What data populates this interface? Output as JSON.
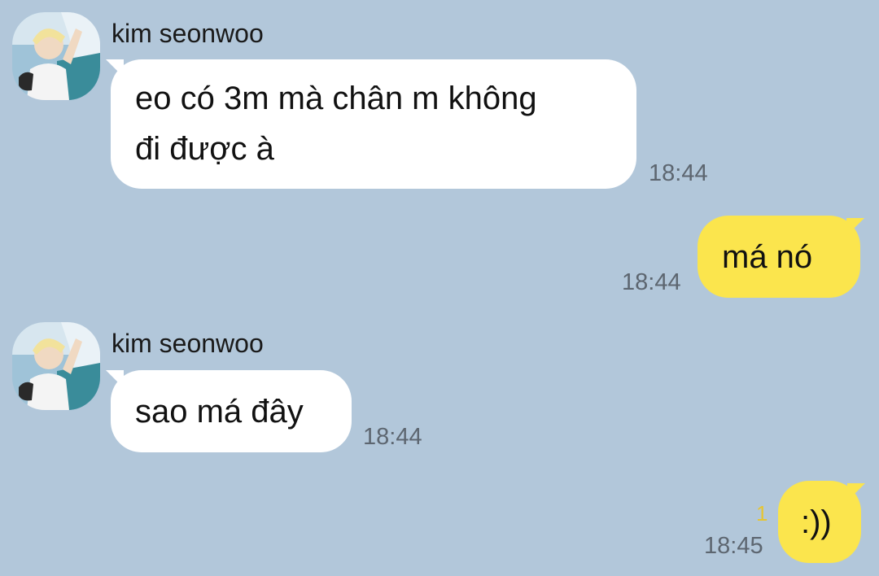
{
  "chat": {
    "messages": [
      {
        "direction": "incoming",
        "sender": "kim seonwoo",
        "lines": [
          "eo có 3m mà chân m không",
          "đi được à"
        ],
        "time": "18:44"
      },
      {
        "direction": "outgoing",
        "lines": [
          "má nó"
        ],
        "time": "18:44"
      },
      {
        "direction": "incoming",
        "sender": "kim seonwoo",
        "lines": [
          "sao má đây"
        ],
        "time": "18:44"
      },
      {
        "direction": "outgoing",
        "lines": [
          ":))"
        ],
        "time": "18:45",
        "unread_count": "1"
      }
    ]
  },
  "theme": {
    "background": "#b2c7da",
    "incoming_bubble": "#ffffff",
    "outgoing_bubble": "#fbe54d",
    "timestamp": "#5d6670",
    "unread": "#e6c533"
  },
  "icons": {
    "avatar": "profile-photo"
  }
}
